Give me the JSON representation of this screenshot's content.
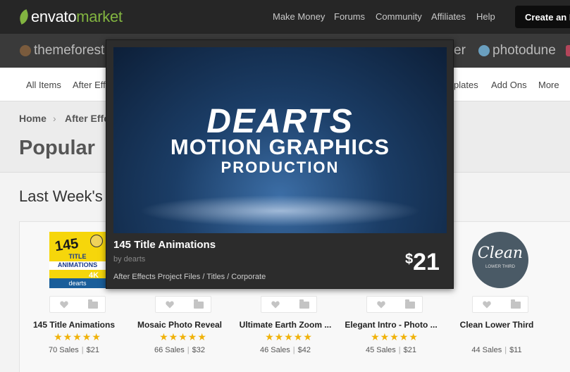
{
  "brand": {
    "part1": "envato",
    "part2": "market"
  },
  "top_nav": [
    "Make Money",
    "Forums",
    "Community",
    "Affiliates",
    "Help"
  ],
  "create_button": "Create an E",
  "marketplaces": {
    "first": "themeforest",
    "partial": "er",
    "last": "photodune"
  },
  "categories": [
    "All Items",
    "After Effe",
    "plates",
    "Add Ons",
    "More"
  ],
  "breadcrumb": {
    "home": "Home",
    "current": "After Effe"
  },
  "page_title": "Popular",
  "section_title": "Last Week's",
  "products": [
    {
      "title": "145 Title Animations",
      "sales": "70 Sales",
      "price": "$21",
      "stars": "★★★★★"
    },
    {
      "title": "Mosaic Photo Reveal",
      "sales": "66 Sales",
      "price": "$32",
      "stars": "★★★★★"
    },
    {
      "title": "Ultimate Earth Zoom ...",
      "sales": "46 Sales",
      "price": "$42",
      "stars": "★★★★★"
    },
    {
      "title": "Elegant Intro - Photo ...",
      "sales": "45 Sales",
      "price": "$21",
      "stars": "★★★★★"
    },
    {
      "title": "Clean Lower Third",
      "sales": "44 Sales",
      "price": "$11",
      "stars": ""
    }
  ],
  "thumb1": {
    "num": "145",
    "title": "TITLE",
    "anim": "ANIMATIONS",
    "k": "4K",
    "author": "dearts"
  },
  "thumb5": {
    "title": "Clean",
    "sub": "LOWER THIRD"
  },
  "popover": {
    "line1": "DEARTS",
    "line2": "MOTION GRAPHICS",
    "line3": "PRODUCTION",
    "title": "145 Title Animations",
    "by": "by dearts",
    "category": "After Effects Project Files / Titles / Corporate",
    "currency": "$",
    "price": "21"
  },
  "colors": {
    "accent": "#82b440",
    "star": "#f0b20a",
    "topbar": "#262626"
  }
}
